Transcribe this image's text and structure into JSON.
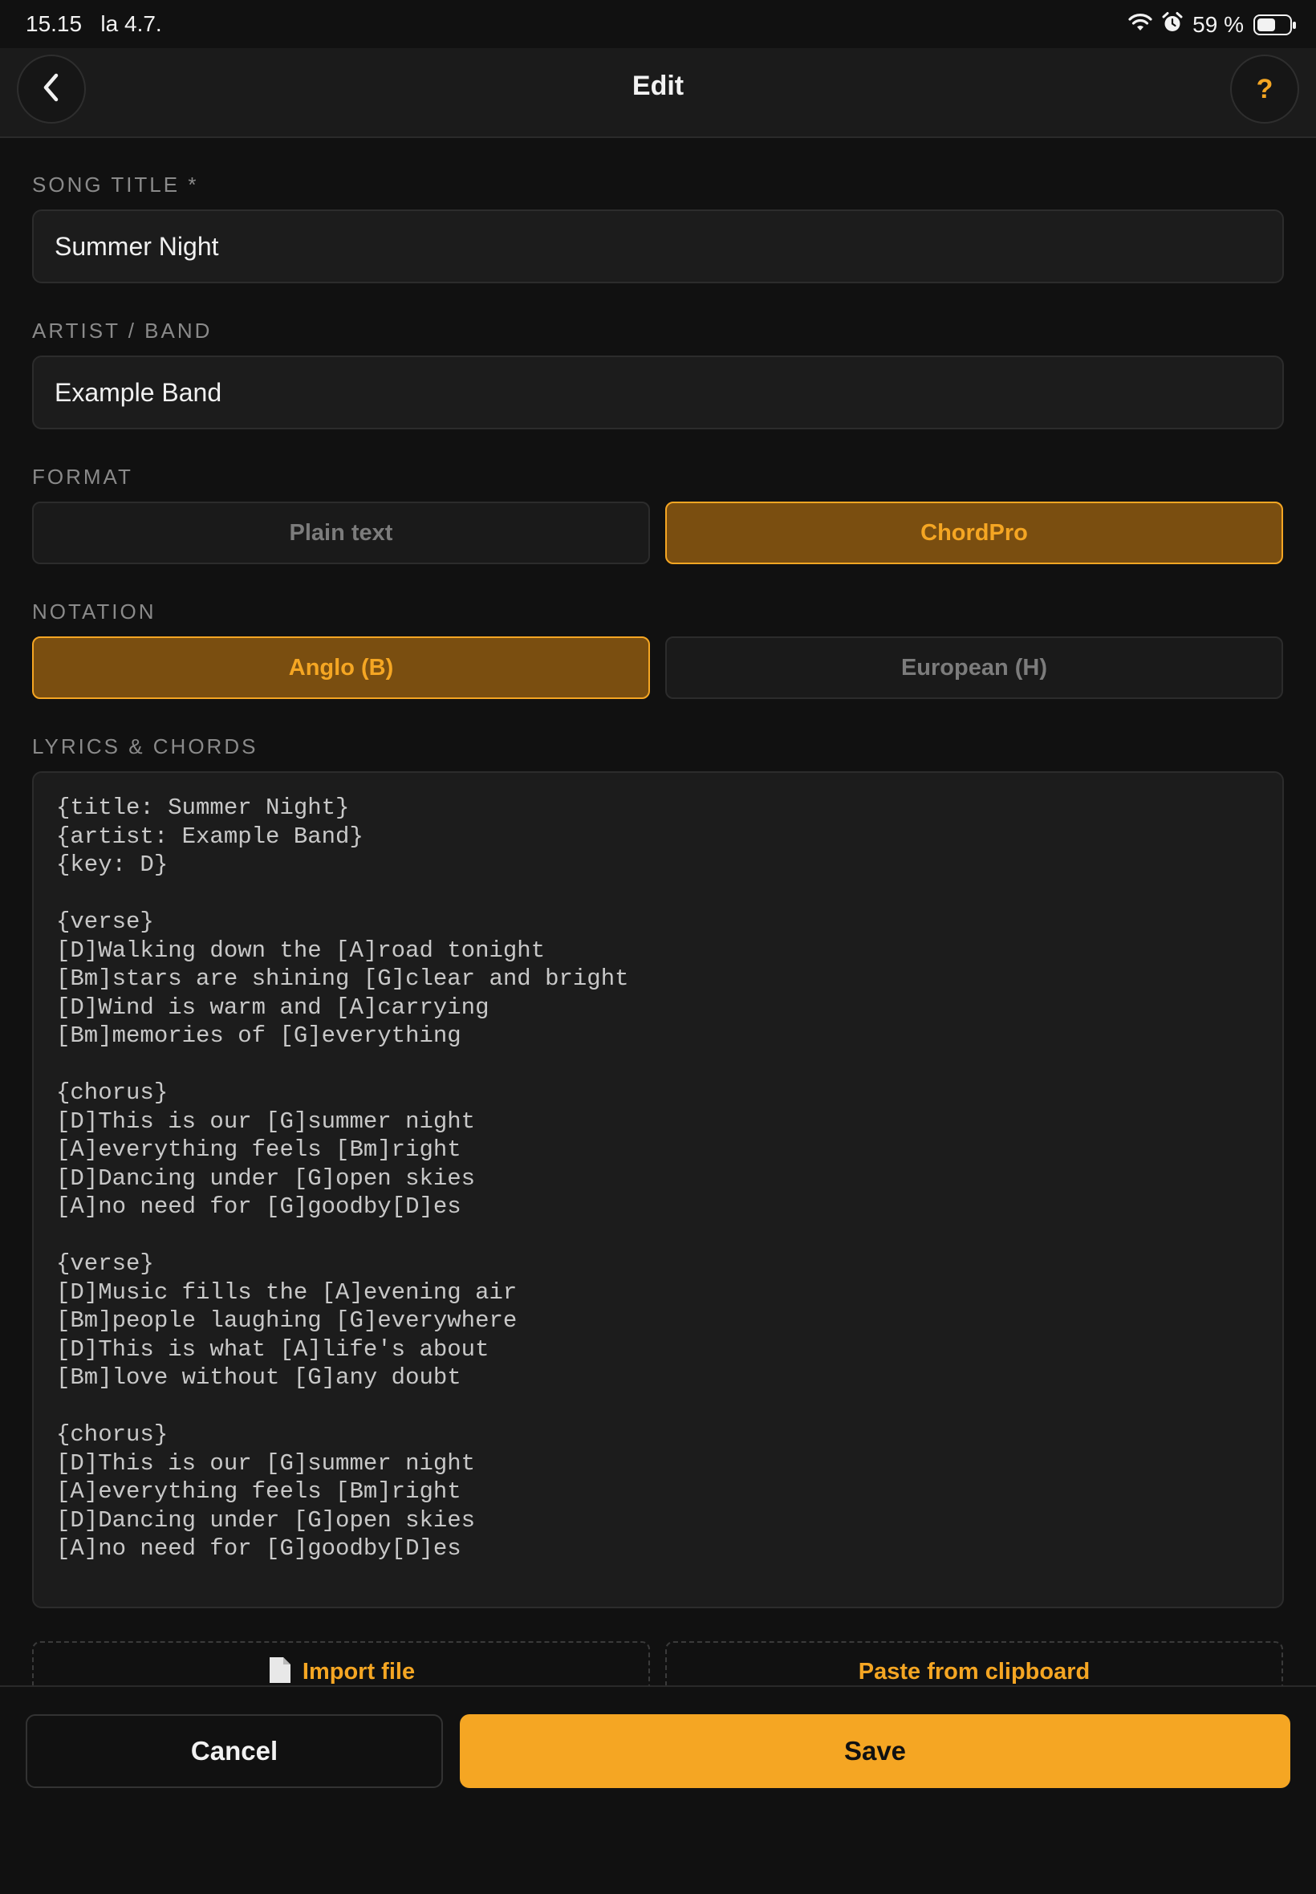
{
  "status_bar": {
    "time": "15.15",
    "date": "la 4.7.",
    "battery": "59 %",
    "battery_level": 0.59,
    "icons": [
      "wifi-icon",
      "alarm-icon",
      "battery-icon"
    ]
  },
  "nav": {
    "title": "Edit",
    "back_icon": "chevron-left-icon",
    "help_label": "?"
  },
  "form": {
    "song_title": {
      "label": "SONG TITLE *",
      "value": "Summer Night"
    },
    "artist": {
      "label": "ARTIST / BAND",
      "value": "Example Band"
    },
    "format": {
      "label": "FORMAT",
      "options": [
        "Plain text",
        "ChordPro"
      ],
      "selected": "ChordPro"
    },
    "notation": {
      "label": "NOTATION",
      "options": [
        "Anglo (B)",
        "European (H)"
      ],
      "selected": "Anglo (B)"
    },
    "lyrics": {
      "label": "LYRICS & CHORDS",
      "value": "{title: Summer Night}\n{artist: Example Band}\n{key: D}\n\n{verse}\n[D]Walking down the [A]road tonight\n[Bm]stars are shining [G]clear and bright\n[D]Wind is warm and [A]carrying\n[Bm]memories of [G]everything\n\n{chorus}\n[D]This is our [G]summer night\n[A]everything feels [Bm]right\n[D]Dancing under [G]open skies\n[A]no need for [G]goodby[D]es\n\n{verse}\n[D]Music fills the [A]evening air\n[Bm]people laughing [G]everywhere\n[D]This is what [A]life's about\n[Bm]love without [G]any doubt\n\n{chorus}\n[D]This is our [G]summer night\n[A]everything feels [Bm]right\n[D]Dancing under [G]open skies\n[A]no need for [G]goodby[D]es"
    },
    "import_label": "Import file",
    "import_icon": "document-icon",
    "paste_label": "Paste from clipboard"
  },
  "actions": {
    "cancel": "Cancel",
    "save": "Save"
  },
  "colors": {
    "accent": "#f5a623",
    "selected_bg": "#7a4e10",
    "background": "#111111",
    "field_bg": "#1c1c1c"
  }
}
